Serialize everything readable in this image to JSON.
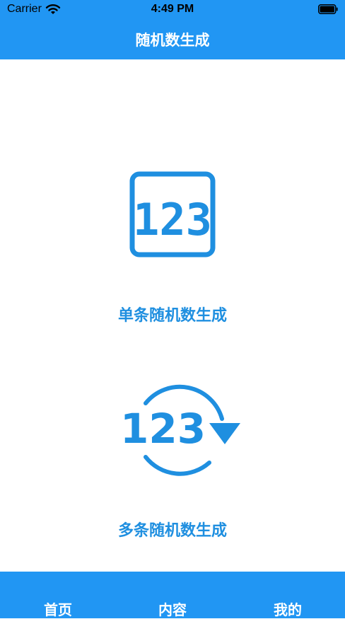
{
  "status_bar": {
    "carrier": "Carrier",
    "time": "4:49 PM"
  },
  "nav": {
    "title": "随机数生成"
  },
  "options": {
    "single": {
      "icon_text": "123",
      "label": "单条随机数生成"
    },
    "multi": {
      "icon_text": "123",
      "label": "多条随机数生成"
    }
  },
  "tabs": {
    "home": "首页",
    "content": "内容",
    "mine": "我的"
  },
  "colors": {
    "primary": "#2196F3",
    "accent": "#1F8FE0"
  }
}
